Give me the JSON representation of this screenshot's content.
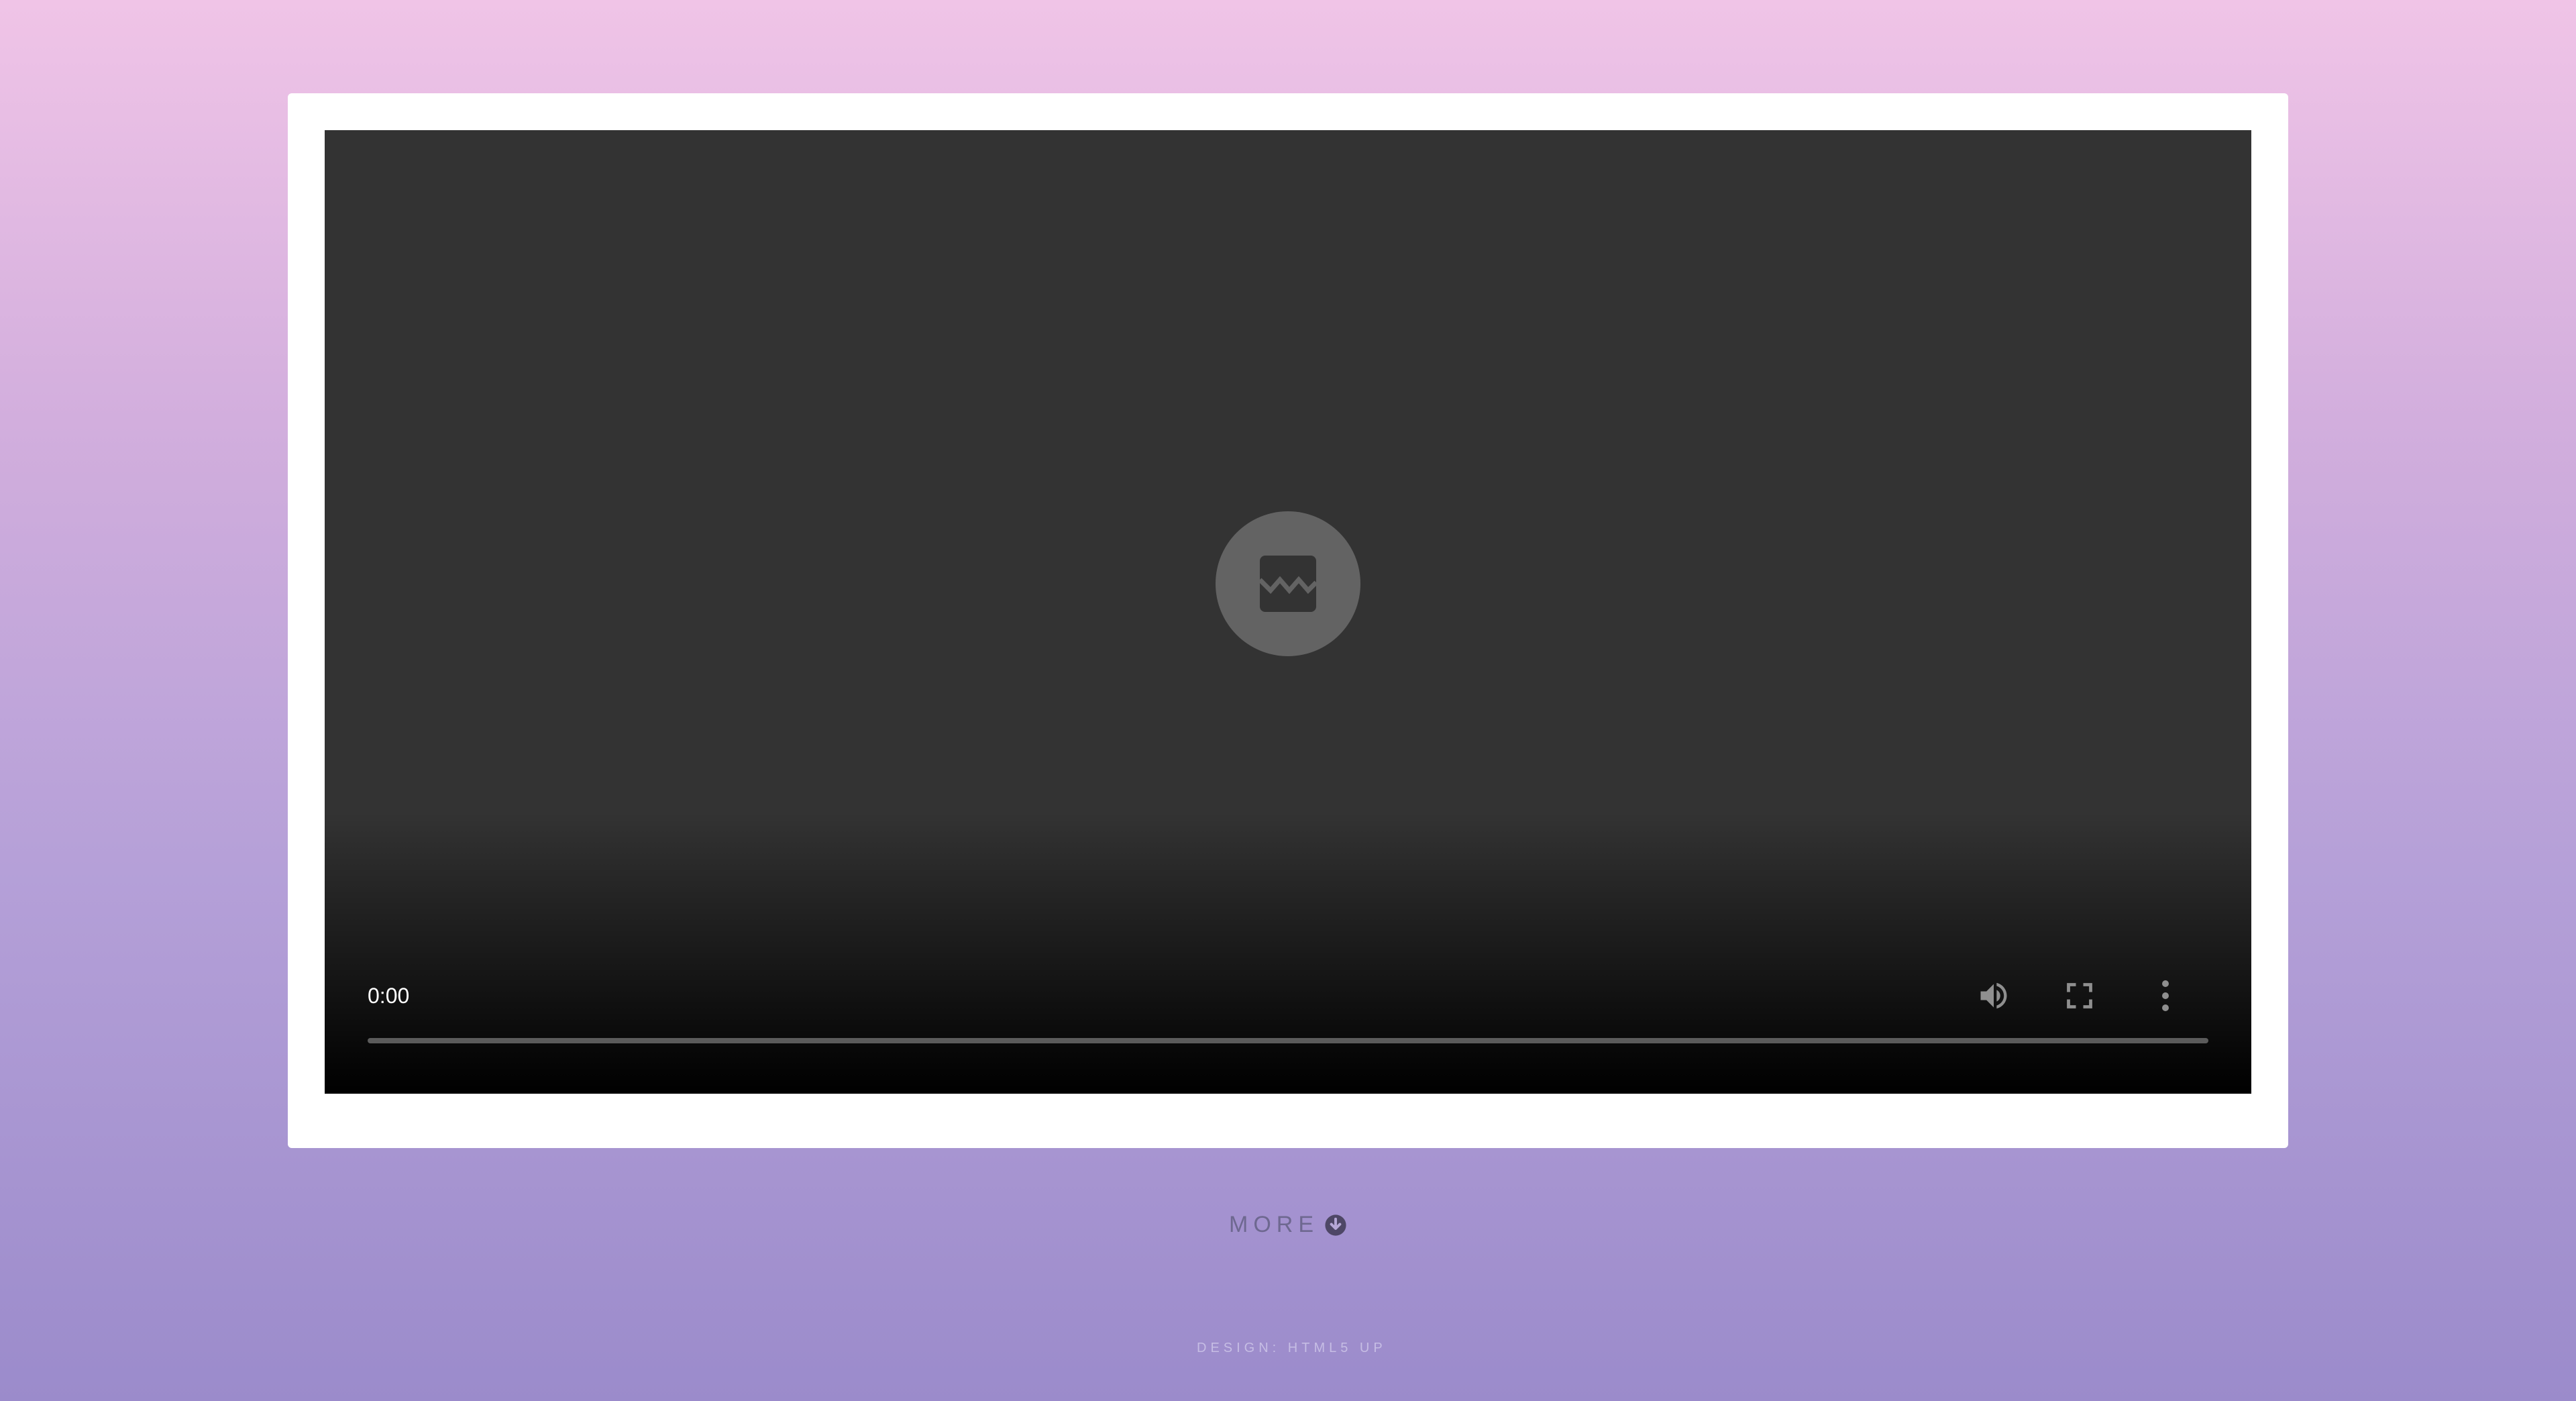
{
  "video": {
    "status_icon": "broken-image-icon",
    "time": "0:00",
    "progress": 0,
    "controls": {
      "volume_icon": "volume-icon",
      "fullscreen_icon": "fullscreen-icon",
      "more_icon": "more-vertical-icon"
    }
  },
  "more_link": {
    "label": "MORE",
    "icon": "arrow-circle-down-icon"
  },
  "footer": {
    "credit": "DESIGN: HTML5 UP"
  },
  "colors": {
    "background_top": "#f0c4e7",
    "background_bottom": "#9b8bcb",
    "video_bg": "#333333",
    "more_text": "#6e6890"
  }
}
